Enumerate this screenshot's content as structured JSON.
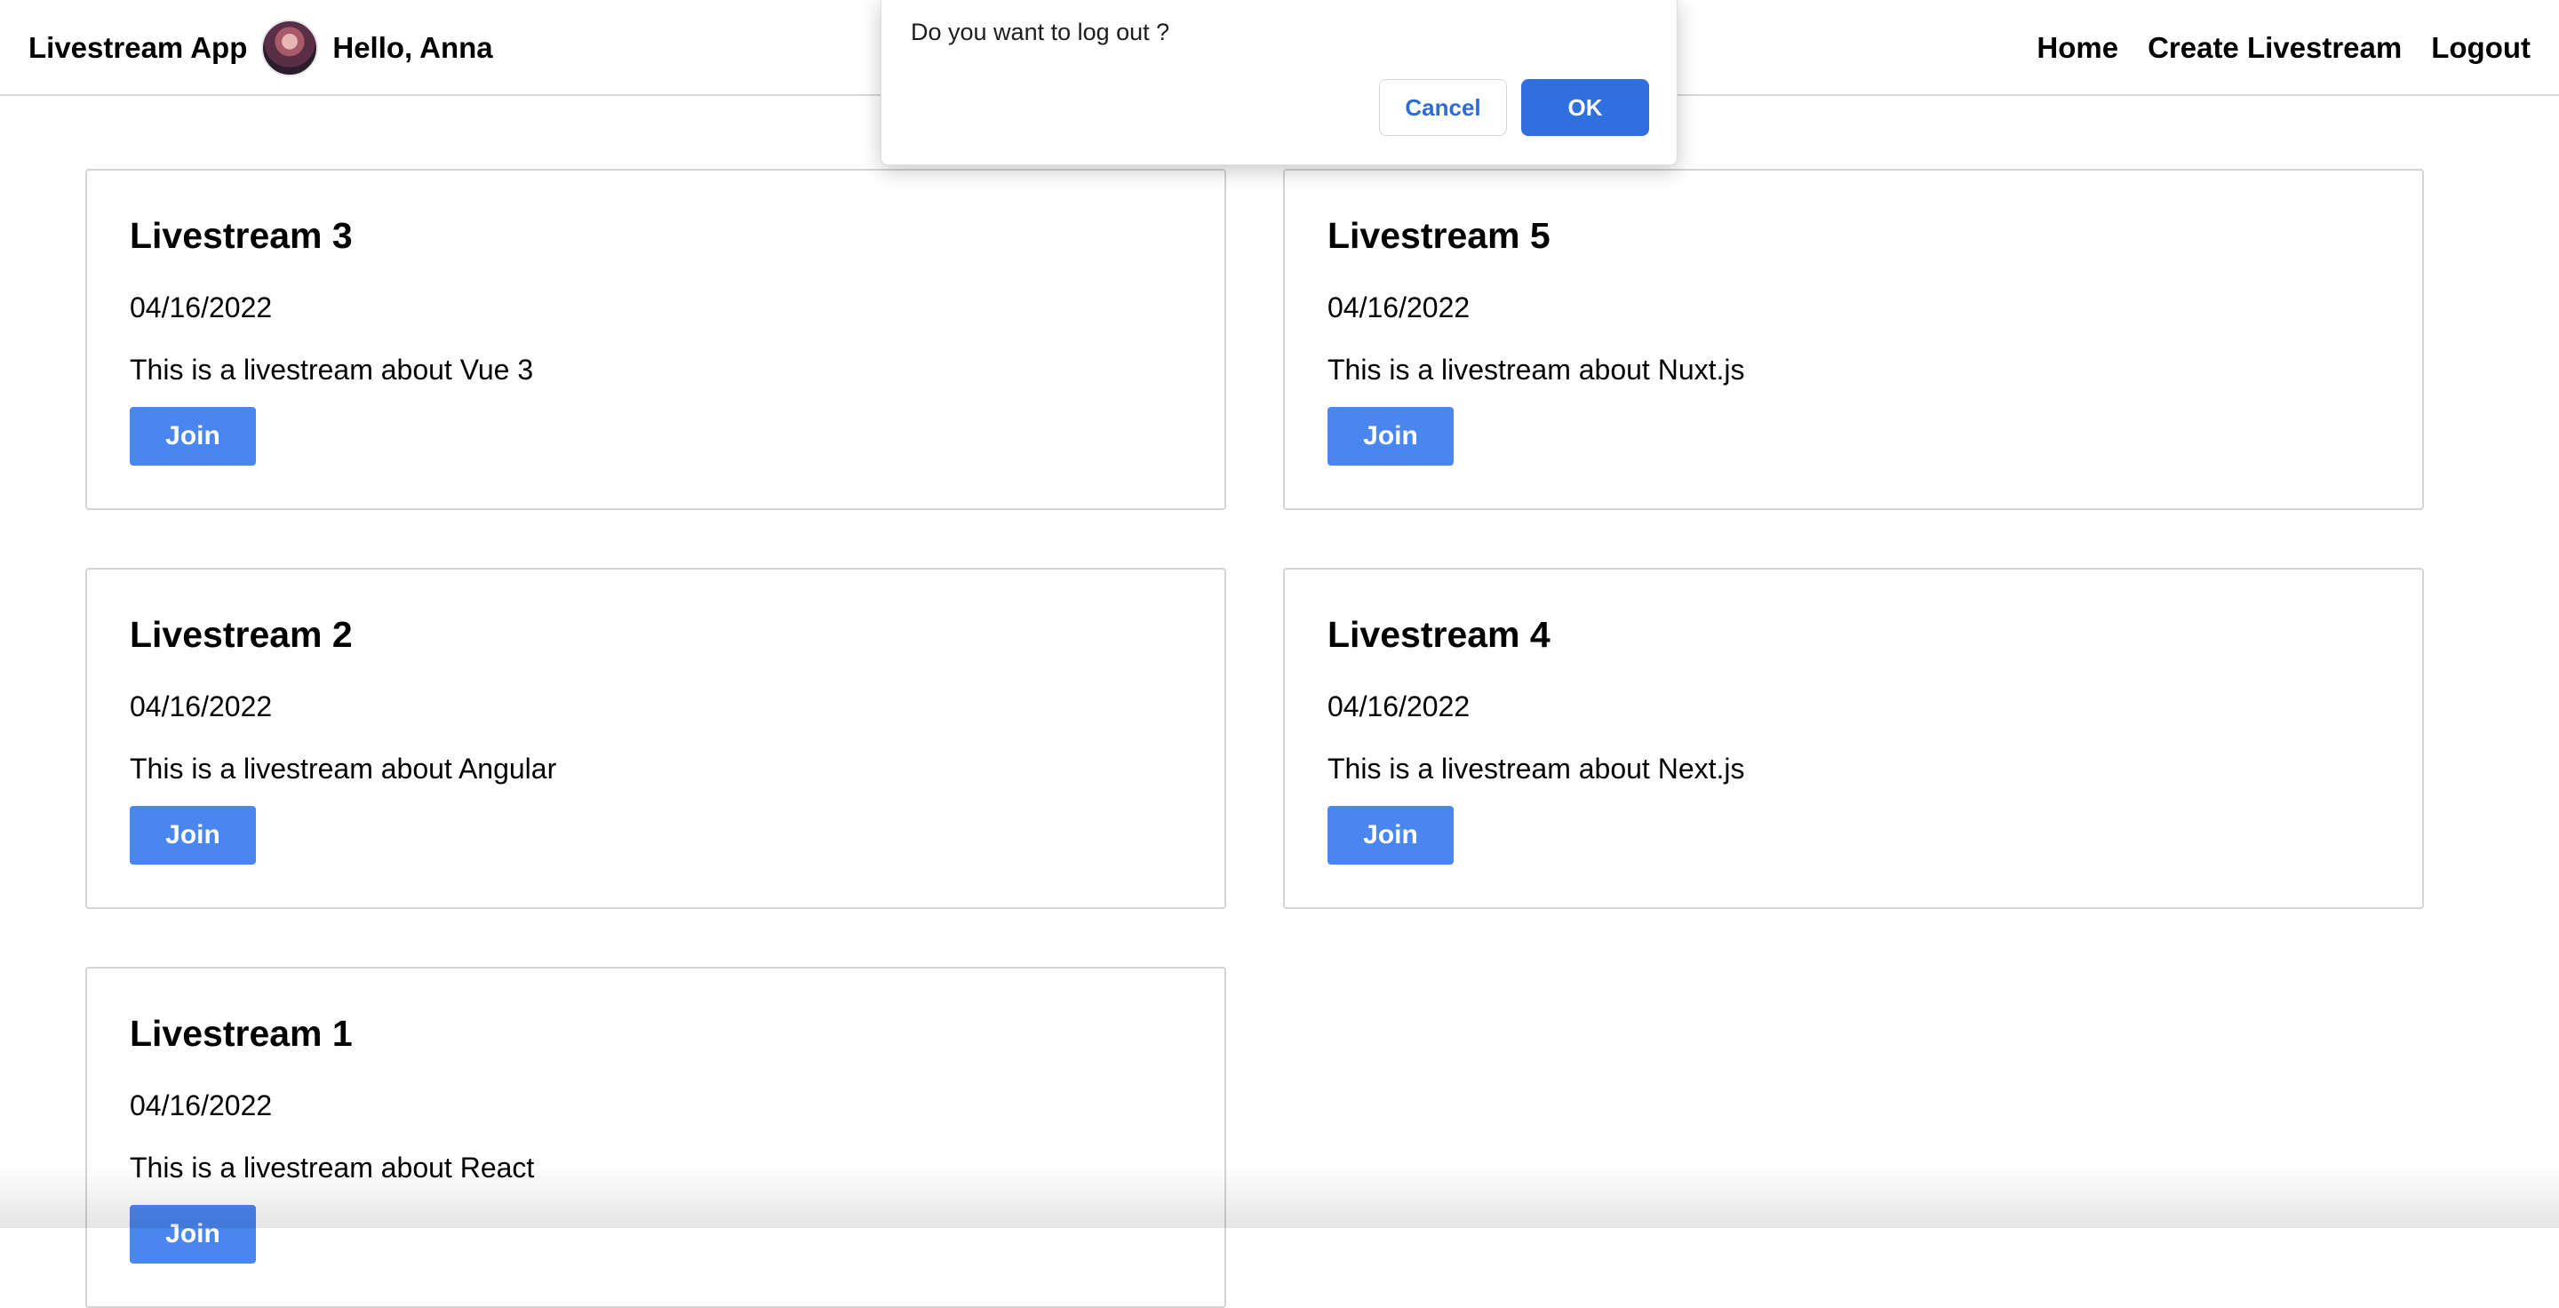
{
  "nav": {
    "app_name": "Livestream App",
    "greeting": "Hello, Anna",
    "links": [
      "Home",
      "Create Livestream",
      "Logout"
    ]
  },
  "dialog": {
    "message": "Do you want to log out ?",
    "cancel_label": "Cancel",
    "ok_label": "OK"
  },
  "livestreams": [
    {
      "title": "Livestream 3",
      "date": "04/16/2022",
      "description": "This is a livestream about Vue 3",
      "join_label": "Join"
    },
    {
      "title": "Livestream 5",
      "date": "04/16/2022",
      "description": "This is a livestream about Nuxt.js",
      "join_label": "Join"
    },
    {
      "title": "Livestream 2",
      "date": "04/16/2022",
      "description": "This is a livestream about Angular",
      "join_label": "Join"
    },
    {
      "title": "Livestream 4",
      "date": "04/16/2022",
      "description": "This is a livestream about Next.js",
      "join_label": "Join"
    },
    {
      "title": "Livestream 1",
      "date": "04/16/2022",
      "description": "This is a livestream about React",
      "join_label": "Join"
    }
  ],
  "colors": {
    "primary": "#4a86f0",
    "dialog_ok": "#2f6fde",
    "dialog_cancel_text": "#2f6bd8",
    "border": "#d4d4d4"
  }
}
